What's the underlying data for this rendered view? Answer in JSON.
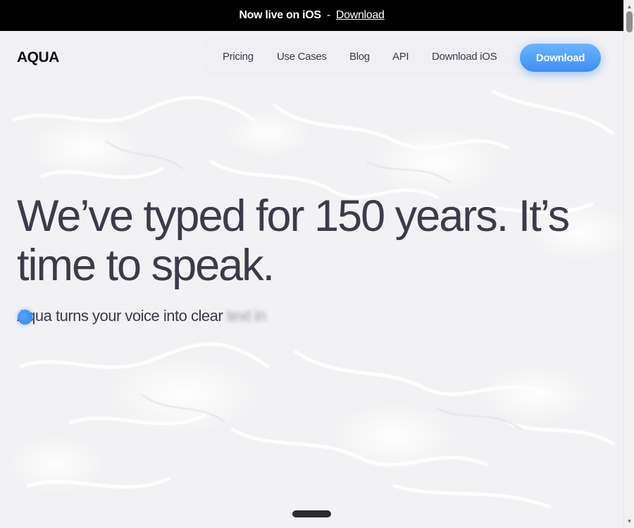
{
  "announcement": {
    "text": "Now live on iOS",
    "separator": "-",
    "link_label": "Download"
  },
  "header": {
    "logo": "AQUA",
    "nav": [
      {
        "label": "Pricing"
      },
      {
        "label": "Use Cases"
      },
      {
        "label": "Blog"
      },
      {
        "label": "API"
      },
      {
        "label": "Download iOS"
      }
    ],
    "cta_label": "Download"
  },
  "hero": {
    "title": "We’ve typed for 150 years. It’s time to speak.",
    "subtitle": "Aqua turns your voice into clear",
    "subtitle_blurred": "text in"
  },
  "colors": {
    "accent": "#3e8ef7",
    "announcement_bg": "#000000",
    "text": "#3b3b4a"
  },
  "icons": {
    "mic": "mic-dot-icon",
    "scroll_up": "chevron-up-icon",
    "scroll_down": "chevron-down-icon"
  }
}
